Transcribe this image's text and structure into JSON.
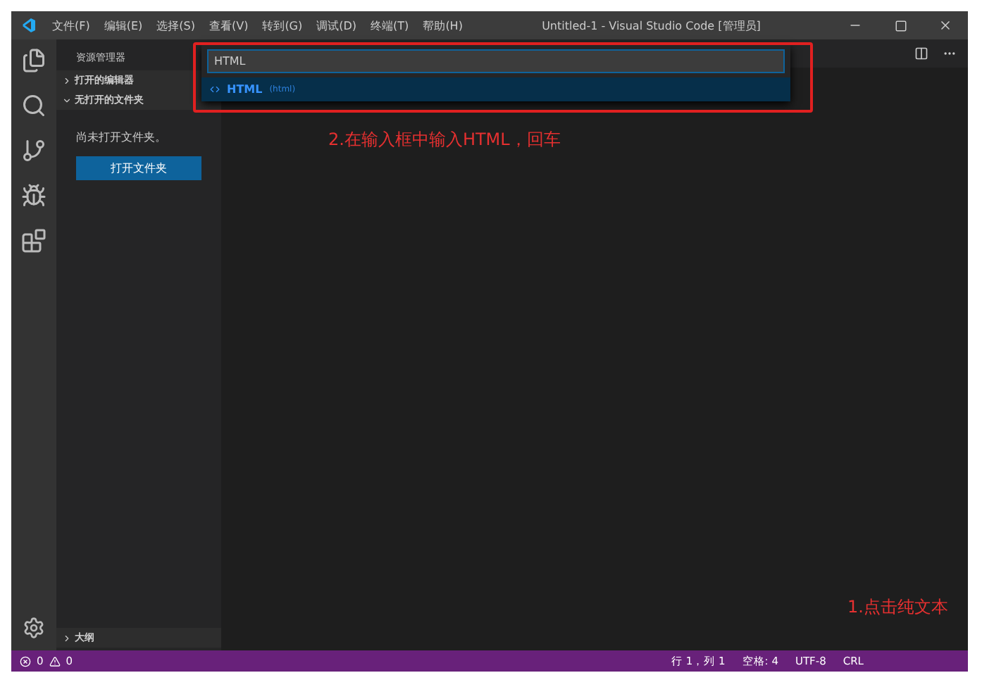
{
  "window": {
    "title": "Untitled-1 - Visual Studio Code [管理员]",
    "menu": [
      "文件(F)",
      "编辑(E)",
      "选择(S)",
      "查看(V)",
      "转到(G)",
      "调试(D)",
      "终端(T)",
      "帮助(H)"
    ]
  },
  "sidebar": {
    "title": "资源管理器",
    "sections": [
      {
        "label": "打开的编辑器",
        "expanded": false
      },
      {
        "label": "无打开的文件夹",
        "expanded": true
      }
    ],
    "message": "尚未打开文件夹。",
    "button": "打开文件夹",
    "outline": {
      "label": "大纲",
      "expanded": false
    }
  },
  "quick_open": {
    "value": "HTML",
    "results": [
      {
        "label": "HTML",
        "detail": "(html)",
        "selected": true
      }
    ]
  },
  "annotations": [
    {
      "text": "2.在输入框中输入HTML，回车"
    },
    {
      "text": "1.点击纯文本"
    }
  ],
  "status_bar": {
    "errors": "0",
    "warnings": "0",
    "items": [
      "行 1，列 1",
      "空格: 4",
      "UTF-8",
      "CRL"
    ]
  }
}
